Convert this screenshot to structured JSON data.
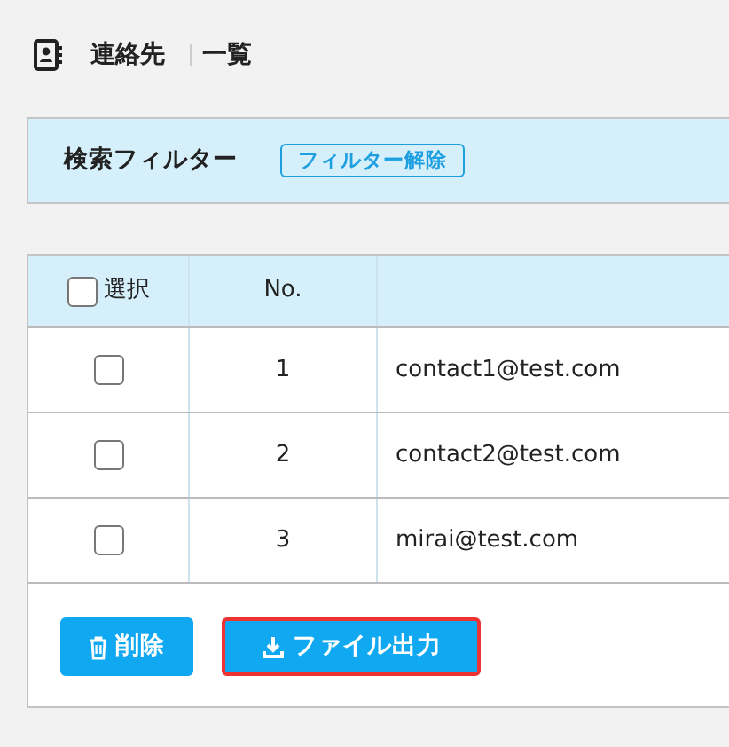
{
  "page_title": {
    "section": "連絡先",
    "view": "一覧"
  },
  "filter_panel": {
    "title": "検索フィルター",
    "clear_button": "フィルター解除"
  },
  "table": {
    "select_all": {
      "label": "選択",
      "checked": false
    },
    "columns": [
      "No."
    ],
    "rows": [
      {
        "checked": false,
        "no": "1",
        "email": "contact1@test.com"
      },
      {
        "checked": false,
        "no": "2",
        "email": "contact2@test.com"
      },
      {
        "checked": false,
        "no": "3",
        "email": "mirai@test.com"
      }
    ]
  },
  "actions": [
    {
      "kind": "delete",
      "label": "削除",
      "highlighted": false
    },
    {
      "kind": "export",
      "label": "ファイル出力",
      "highlighted": true
    }
  ]
}
